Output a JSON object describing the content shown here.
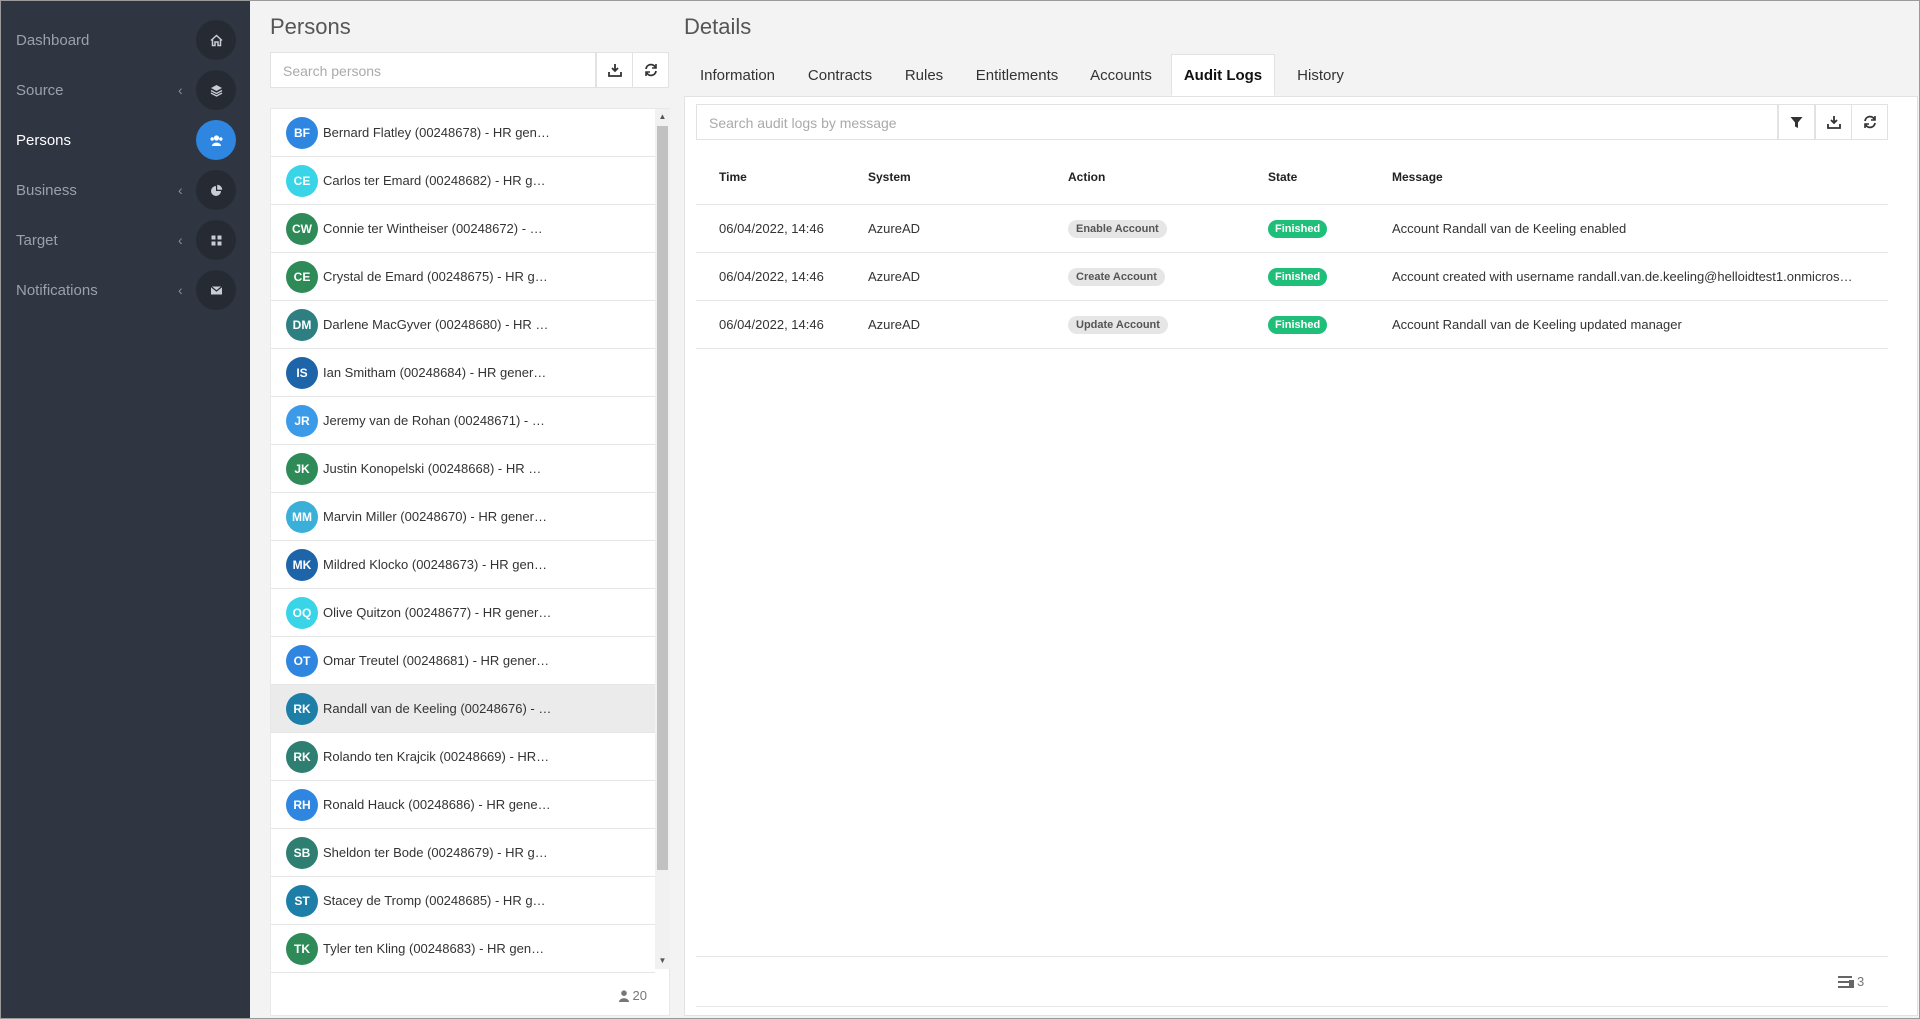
{
  "sidebar": {
    "items": [
      {
        "label": "Dashboard",
        "icon": "home-icon",
        "chevron": false,
        "active": false
      },
      {
        "label": "Source",
        "icon": "layers-icon",
        "chevron": true,
        "active": false
      },
      {
        "label": "Persons",
        "icon": "users-icon",
        "chevron": false,
        "active": true
      },
      {
        "label": "Business",
        "icon": "pie-chart-icon",
        "chevron": true,
        "active": false
      },
      {
        "label": "Target",
        "icon": "grid-icon",
        "chevron": true,
        "active": false
      },
      {
        "label": "Notifications",
        "icon": "envelope-icon",
        "chevron": true,
        "active": false
      }
    ],
    "chevron_glyph": "‹"
  },
  "persons": {
    "title": "Persons",
    "search_placeholder": "Search persons",
    "count": "20",
    "items": [
      {
        "initials": "BF",
        "name": "Bernard Flatley (00248678) - HR gen…",
        "color": "#2f86e0",
        "selected": false
      },
      {
        "initials": "CE",
        "name": "Carlos ter Emard (00248682) - HR g…",
        "color": "#3ad4e8",
        "selected": false
      },
      {
        "initials": "CW",
        "name": "Connie ter Wintheiser (00248672) - …",
        "color": "#2e8b57",
        "selected": false
      },
      {
        "initials": "CE",
        "name": "Crystal de Emard (00248675) - HR g…",
        "color": "#2e8b57",
        "selected": false
      },
      {
        "initials": "DM",
        "name": "Darlene MacGyver (00248680) - HR …",
        "color": "#2e7f82",
        "selected": false
      },
      {
        "initials": "IS",
        "name": "Ian Smitham (00248684) - HR gener…",
        "color": "#1d64a8",
        "selected": false
      },
      {
        "initials": "JR",
        "name": "Jeremy van de Rohan (00248671) - …",
        "color": "#3b9be8",
        "selected": false
      },
      {
        "initials": "JK",
        "name": "Justin Konopelski (00248668) - HR …",
        "color": "#2e8b57",
        "selected": false
      },
      {
        "initials": "MM",
        "name": "Marvin Miller (00248670) - HR gener…",
        "color": "#3aafd8",
        "selected": false
      },
      {
        "initials": "MK",
        "name": "Mildred Klocko (00248673) - HR gen…",
        "color": "#1d64a8",
        "selected": false
      },
      {
        "initials": "OQ",
        "name": "Olive Quitzon (00248677) - HR gener…",
        "color": "#3ad4e8",
        "selected": false
      },
      {
        "initials": "OT",
        "name": "Omar Treutel (00248681) - HR gener…",
        "color": "#2f86e0",
        "selected": false
      },
      {
        "initials": "RK",
        "name": "Randall van de Keeling (00248676) - …",
        "color": "#1d7fa8",
        "selected": true
      },
      {
        "initials": "RK",
        "name": "Rolando ten Krajcik (00248669) - HR…",
        "color": "#2e7f72",
        "selected": false
      },
      {
        "initials": "RH",
        "name": "Ronald Hauck (00248686) - HR gene…",
        "color": "#2f86e0",
        "selected": false
      },
      {
        "initials": "SB",
        "name": "Sheldon ter Bode (00248679) - HR g…",
        "color": "#2e7f72",
        "selected": false
      },
      {
        "initials": "ST",
        "name": "Stacey de Tromp (00248685) - HR g…",
        "color": "#1d7fa8",
        "selected": false
      },
      {
        "initials": "TK",
        "name": "Tyler ten Kling (00248683) - HR gen…",
        "color": "#2e8b57",
        "selected": false
      }
    ]
  },
  "details": {
    "title": "Details",
    "tabs": [
      "Information",
      "Contracts",
      "Rules",
      "Entitlements",
      "Accounts",
      "Audit Logs",
      "History"
    ],
    "active_tab": "Audit Logs",
    "search_placeholder": "Search audit logs by message",
    "columns": [
      "Time",
      "System",
      "Action",
      "State",
      "Message"
    ],
    "rows": [
      {
        "time": "06/04/2022, 14:46",
        "system": "AzureAD",
        "action": "Enable Account",
        "state": "Finished",
        "message": "Account Randall van de Keeling enabled"
      },
      {
        "time": "06/04/2022, 14:46",
        "system": "AzureAD",
        "action": "Create Account",
        "state": "Finished",
        "message": "Account created with username randall.van.de.keeling@helloidtest1.onmicros…"
      },
      {
        "time": "06/04/2022, 14:46",
        "system": "AzureAD",
        "action": "Update Account",
        "state": "Finished",
        "message": "Account Randall van de Keeling updated manager"
      }
    ],
    "count": "3"
  },
  "colors": {
    "sidebar_bg": "#2f3541",
    "accent": "#2f86e0",
    "finished": "#1fbf7a"
  }
}
